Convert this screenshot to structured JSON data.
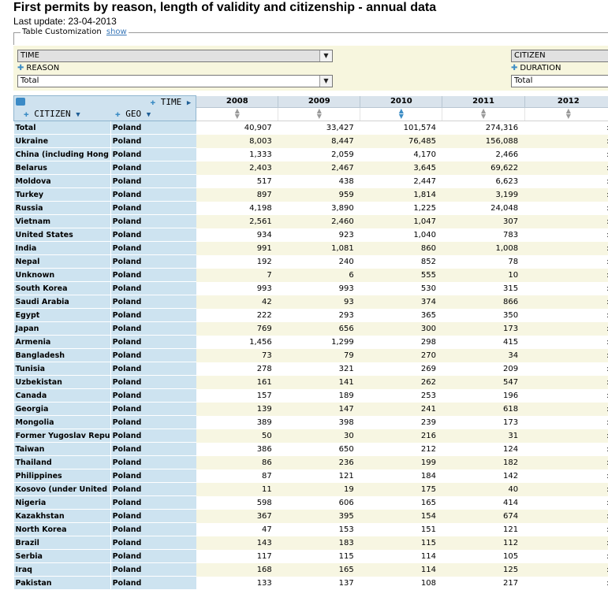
{
  "page": {
    "title": "First permits by reason, length of validity and citizenship - annual data",
    "last_update": "Last update: 23-04-2013"
  },
  "customization": {
    "legend": "Table Customization",
    "show_link": "show"
  },
  "selectors": {
    "time": {
      "label": "TIME"
    },
    "reason": {
      "label": "REASON",
      "value": "Total"
    },
    "citizen": {
      "label": "CITIZEN"
    },
    "duration": {
      "label": "DURATION",
      "value": "Total"
    }
  },
  "grid": {
    "corner": {
      "time": "TIME",
      "citizen": "CITIZEN",
      "geo": "GEO"
    },
    "years": [
      "2008",
      "2009",
      "2010",
      "2011",
      "2012"
    ],
    "rows": [
      {
        "citizen": "Total",
        "geo": "Poland",
        "v": [
          "40,907",
          "33,427",
          "101,574",
          "274,316",
          ":"
        ]
      },
      {
        "citizen": "Ukraine",
        "geo": "Poland",
        "v": [
          "8,003",
          "8,447",
          "76,485",
          "156,088",
          ":"
        ]
      },
      {
        "citizen": "China (including Hong",
        "geo": "Poland",
        "v": [
          "1,333",
          "2,059",
          "4,170",
          "2,466",
          ":"
        ]
      },
      {
        "citizen": "Belarus",
        "geo": "Poland",
        "v": [
          "2,403",
          "2,467",
          "3,645",
          "69,622",
          ":"
        ]
      },
      {
        "citizen": "Moldova",
        "geo": "Poland",
        "v": [
          "517",
          "438",
          "2,447",
          "6,623",
          ":"
        ]
      },
      {
        "citizen": "Turkey",
        "geo": "Poland",
        "v": [
          "897",
          "959",
          "1,814",
          "3,199",
          ":"
        ]
      },
      {
        "citizen": "Russia",
        "geo": "Poland",
        "v": [
          "4,198",
          "3,890",
          "1,225",
          "24,048",
          ":"
        ]
      },
      {
        "citizen": "Vietnam",
        "geo": "Poland",
        "v": [
          "2,561",
          "2,460",
          "1,047",
          "307",
          ":"
        ]
      },
      {
        "citizen": "United States",
        "geo": "Poland",
        "v": [
          "934",
          "923",
          "1,040",
          "783",
          ":"
        ]
      },
      {
        "citizen": "India",
        "geo": "Poland",
        "v": [
          "991",
          "1,081",
          "860",
          "1,008",
          ":"
        ]
      },
      {
        "citizen": "Nepal",
        "geo": "Poland",
        "v": [
          "192",
          "240",
          "852",
          "78",
          ":"
        ]
      },
      {
        "citizen": "Unknown",
        "geo": "Poland",
        "v": [
          "7",
          "6",
          "555",
          "10",
          ":"
        ]
      },
      {
        "citizen": "South Korea",
        "geo": "Poland",
        "v": [
          "993",
          "993",
          "530",
          "315",
          ":"
        ]
      },
      {
        "citizen": "Saudi Arabia",
        "geo": "Poland",
        "v": [
          "42",
          "93",
          "374",
          "866",
          ":"
        ]
      },
      {
        "citizen": "Egypt",
        "geo": "Poland",
        "v": [
          "222",
          "293",
          "365",
          "350",
          ":"
        ]
      },
      {
        "citizen": "Japan",
        "geo": "Poland",
        "v": [
          "769",
          "656",
          "300",
          "173",
          ":"
        ]
      },
      {
        "citizen": "Armenia",
        "geo": "Poland",
        "v": [
          "1,456",
          "1,299",
          "298",
          "415",
          ":"
        ]
      },
      {
        "citizen": "Bangladesh",
        "geo": "Poland",
        "v": [
          "73",
          "79",
          "270",
          "34",
          ":"
        ]
      },
      {
        "citizen": "Tunisia",
        "geo": "Poland",
        "v": [
          "278",
          "321",
          "269",
          "209",
          ":"
        ]
      },
      {
        "citizen": "Uzbekistan",
        "geo": "Poland",
        "v": [
          "161",
          "141",
          "262",
          "547",
          ":"
        ]
      },
      {
        "citizen": "Canada",
        "geo": "Poland",
        "v": [
          "157",
          "189",
          "253",
          "196",
          ":"
        ]
      },
      {
        "citizen": "Georgia",
        "geo": "Poland",
        "v": [
          "139",
          "147",
          "241",
          "618",
          ":"
        ]
      },
      {
        "citizen": "Mongolia",
        "geo": "Poland",
        "v": [
          "389",
          "398",
          "239",
          "173",
          ":"
        ]
      },
      {
        "citizen": "Former Yugoslav Repu",
        "geo": "Poland",
        "v": [
          "50",
          "30",
          "216",
          "31",
          ":"
        ]
      },
      {
        "citizen": "Taiwan",
        "geo": "Poland",
        "v": [
          "386",
          "650",
          "212",
          "124",
          ":"
        ]
      },
      {
        "citizen": "Thailand",
        "geo": "Poland",
        "v": [
          "86",
          "236",
          "199",
          "182",
          ":"
        ]
      },
      {
        "citizen": "Philippines",
        "geo": "Poland",
        "v": [
          "87",
          "121",
          "184",
          "142",
          ":"
        ]
      },
      {
        "citizen": "Kosovo (under United",
        "geo": "Poland",
        "v": [
          "11",
          "19",
          "175",
          "40",
          ":"
        ]
      },
      {
        "citizen": "Nigeria",
        "geo": "Poland",
        "v": [
          "598",
          "606",
          "165",
          "414",
          ":"
        ]
      },
      {
        "citizen": "Kazakhstan",
        "geo": "Poland",
        "v": [
          "367",
          "395",
          "154",
          "674",
          ":"
        ]
      },
      {
        "citizen": "North Korea",
        "geo": "Poland",
        "v": [
          "47",
          "153",
          "151",
          "121",
          ":"
        ]
      },
      {
        "citizen": "Brazil",
        "geo": "Poland",
        "v": [
          "143",
          "183",
          "115",
          "112",
          ":"
        ]
      },
      {
        "citizen": "Serbia",
        "geo": "Poland",
        "v": [
          "117",
          "115",
          "114",
          "105",
          ":"
        ]
      },
      {
        "citizen": "Iraq",
        "geo": "Poland",
        "v": [
          "168",
          "165",
          "114",
          "125",
          ":"
        ]
      },
      {
        "citizen": "Pakistan",
        "geo": "Poland",
        "v": [
          "133",
          "137",
          "108",
          "217",
          ":"
        ]
      }
    ]
  }
}
